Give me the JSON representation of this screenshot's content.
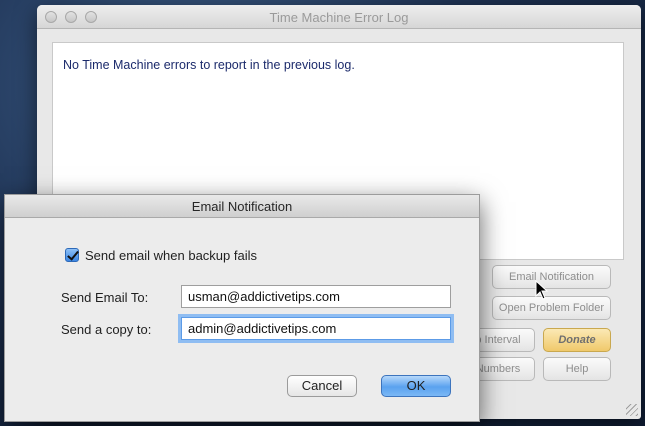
{
  "main_window": {
    "title": "Time Machine Error Log",
    "log_message": "No Time Machine errors to report in the previous log.",
    "buttons": {
      "email_notification": "Email Notification",
      "open_problem_folder": "Open Problem Folder",
      "backup_interval": "p Interval",
      "donate": "Donate",
      "numbers": "Numbers",
      "help": "Help"
    }
  },
  "dialog": {
    "title": "Email Notification",
    "checkbox_label": "Send email when backup fails",
    "checkbox_checked": true,
    "send_to_label": "Send Email To:",
    "send_to_value": "usman@addictivetips.com",
    "copy_to_label": "Send a copy to:",
    "copy_to_value": "admin@addictivetips.com",
    "cancel_label": "Cancel",
    "ok_label": "OK"
  },
  "colors": {
    "accent": "#5aa2ef",
    "donate": "#f0c96b",
    "log_text": "#1b2a6b"
  }
}
